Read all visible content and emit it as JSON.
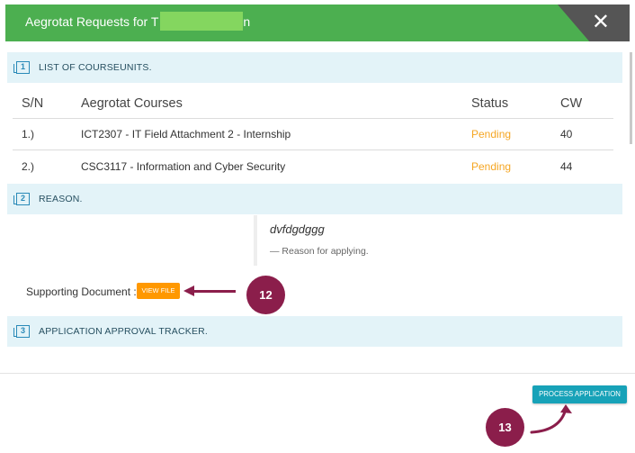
{
  "header": {
    "title_prefix": "Aegrotat Requests for T",
    "title_suffix": "n",
    "close_glyph": "✕"
  },
  "sections": {
    "courseunits": {
      "number": "1",
      "label": "LIST OF COURSEUNITS."
    },
    "reason": {
      "number": "2",
      "label": "REASON."
    },
    "tracker": {
      "number": "3",
      "label": "APPLICATION APPROVAL TRACKER."
    }
  },
  "table": {
    "headers": [
      "S/N",
      "Aegrotat Courses",
      "Status",
      "CW"
    ],
    "rows": [
      {
        "sn": "1.)",
        "course": "ICT2307 - IT Field Attachment 2 - Internship",
        "status": "Pending",
        "cw": "40"
      },
      {
        "sn": "2.)",
        "course": "CSC3117 - Information and Cyber Security",
        "status": "Pending",
        "cw": "44"
      }
    ]
  },
  "reason": {
    "text": "dvfdgdggg",
    "footer": "— Reason for applying."
  },
  "supporting": {
    "label": "Supporting Document :",
    "button": "VIEW FILE"
  },
  "annotations": {
    "marker_12": "12",
    "marker_13": "13"
  },
  "footer": {
    "process_button": "PROCESS APPLICATION"
  },
  "colors": {
    "header_bg": "#4caf50",
    "section_bg": "#e3f3f8",
    "pending": "#f5a623",
    "view_button": "#ff9800",
    "process_button": "#17a2b8",
    "annotation": "#8b1e4b"
  },
  "icons": {
    "close": "close-icon",
    "section": "list-box-icon"
  }
}
